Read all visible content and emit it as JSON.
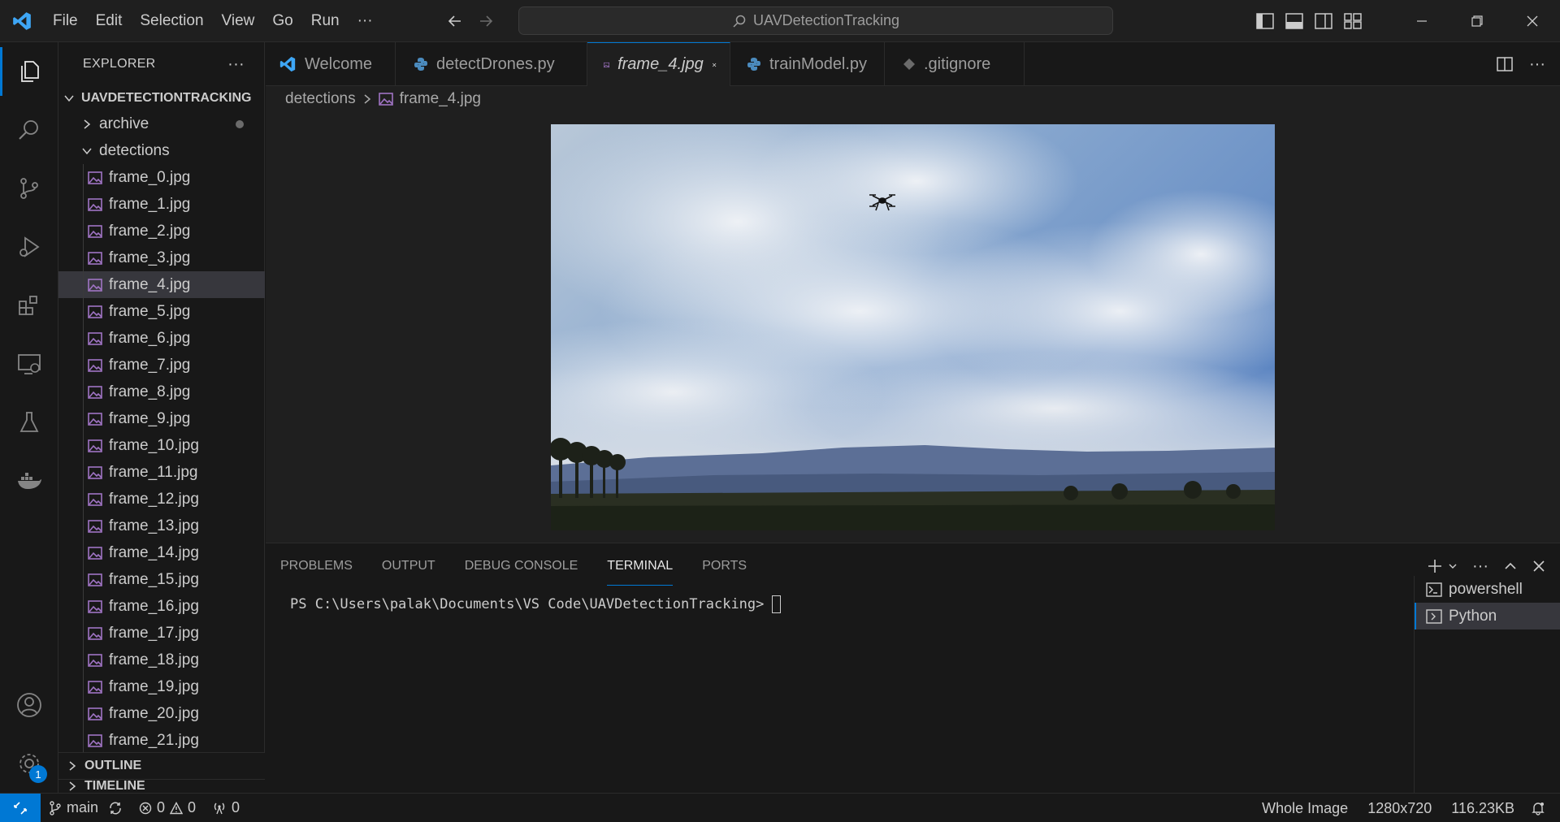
{
  "titlebar": {
    "menu": [
      "File",
      "Edit",
      "Selection",
      "View",
      "Go",
      "Run",
      "···"
    ],
    "search_text": "UAVDetectionTracking"
  },
  "sidebar": {
    "title": "EXPLORER",
    "root": "UAVDETECTIONTRACKING",
    "folders": {
      "archive": "archive",
      "detections": "detections"
    },
    "files": [
      "frame_0.jpg",
      "frame_1.jpg",
      "frame_2.jpg",
      "frame_3.jpg",
      "frame_4.jpg",
      "frame_5.jpg",
      "frame_6.jpg",
      "frame_7.jpg",
      "frame_8.jpg",
      "frame_9.jpg",
      "frame_10.jpg",
      "frame_11.jpg",
      "frame_12.jpg",
      "frame_13.jpg",
      "frame_14.jpg",
      "frame_15.jpg",
      "frame_16.jpg",
      "frame_17.jpg",
      "frame_18.jpg",
      "frame_19.jpg",
      "frame_20.jpg",
      "frame_21.jpg"
    ],
    "selected_file": "frame_4.jpg",
    "outline": "OUTLINE",
    "timeline": "TIMELINE",
    "settings_badge": "1"
  },
  "tabs": [
    {
      "label": "Welcome",
      "icon": "vscode-icon"
    },
    {
      "label": "detectDrones.py",
      "icon": "python-icon"
    },
    {
      "label": "frame_4.jpg",
      "icon": "image-icon",
      "active": true
    },
    {
      "label": "trainModel.py",
      "icon": "python-icon"
    },
    {
      "label": ".gitignore",
      "icon": "git-icon"
    }
  ],
  "breadcrumb": {
    "folder": "detections",
    "file": "frame_4.jpg"
  },
  "panel": {
    "tabs": [
      "PROBLEMS",
      "OUTPUT",
      "DEBUG CONSOLE",
      "TERMINAL",
      "PORTS"
    ],
    "active_tab": "TERMINAL",
    "prompt": "PS C:\\Users\\palak\\Documents\\VS Code\\UAVDetectionTracking>",
    "terminals": [
      "powershell",
      "Python"
    ]
  },
  "statusbar": {
    "branch": "main",
    "errors": "0",
    "warnings": "0",
    "ports": "0",
    "zoom": "Whole Image",
    "dimensions": "1280x720",
    "size": "116.23KB"
  },
  "colors": {
    "accent": "#0078d4",
    "background": "#1f1f1f",
    "sidebar": "#181818"
  }
}
